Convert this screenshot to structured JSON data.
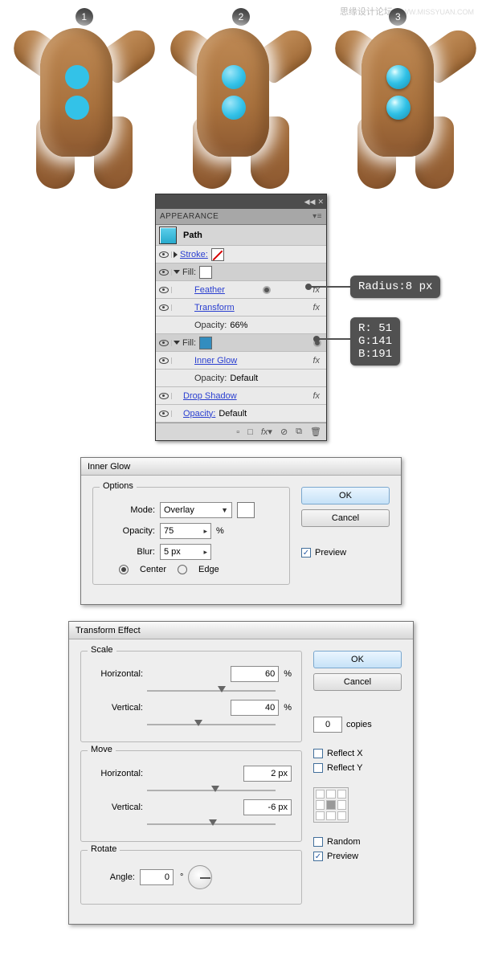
{
  "watermark": {
    "main": "思缘设计论坛",
    "sub": "WWW.MISSYUAN.COM"
  },
  "steps": [
    "1",
    "2",
    "3"
  ],
  "appearance": {
    "title": "APPEARANCE",
    "path": "Path",
    "stroke": "Stroke:",
    "fill": "Fill:",
    "feather": "Feather",
    "transform": "Transform",
    "opacity_label": "Opacity:",
    "opacity_66": "66%",
    "inner_glow": "Inner Glow",
    "opacity_default": "Default",
    "drop_shadow": "Drop Shadow",
    "fx": "fx"
  },
  "callouts": {
    "radius": "Radius:8 px",
    "rgb_r": "R:  51",
    "rgb_g": "G:141",
    "rgb_b": "B:191"
  },
  "inner_glow_dialog": {
    "title": "Inner Glow",
    "options": "Options",
    "mode": "Mode:",
    "mode_value": "Overlay",
    "opacity": "Opacity:",
    "opacity_value": "75",
    "blur": "Blur:",
    "blur_value": "5 px",
    "center": "Center",
    "edge": "Edge",
    "ok": "OK",
    "cancel": "Cancel",
    "preview": "Preview",
    "percent": "%"
  },
  "transform_dialog": {
    "title": "Transform Effect",
    "scale": "Scale",
    "move": "Move",
    "rotate": "Rotate",
    "horizontal": "Horizontal:",
    "vertical": "Vertical:",
    "angle": "Angle:",
    "scale_h": "60",
    "scale_v": "40",
    "move_h": "2 px",
    "move_v": "-6 px",
    "angle_v": "0",
    "copies_v": "0",
    "copies": "copies",
    "reflect_x": "Reflect X",
    "reflect_y": "Reflect Y",
    "random": "Random",
    "preview": "Preview",
    "ok": "OK",
    "cancel": "Cancel",
    "percent": "%",
    "deg": "°"
  }
}
